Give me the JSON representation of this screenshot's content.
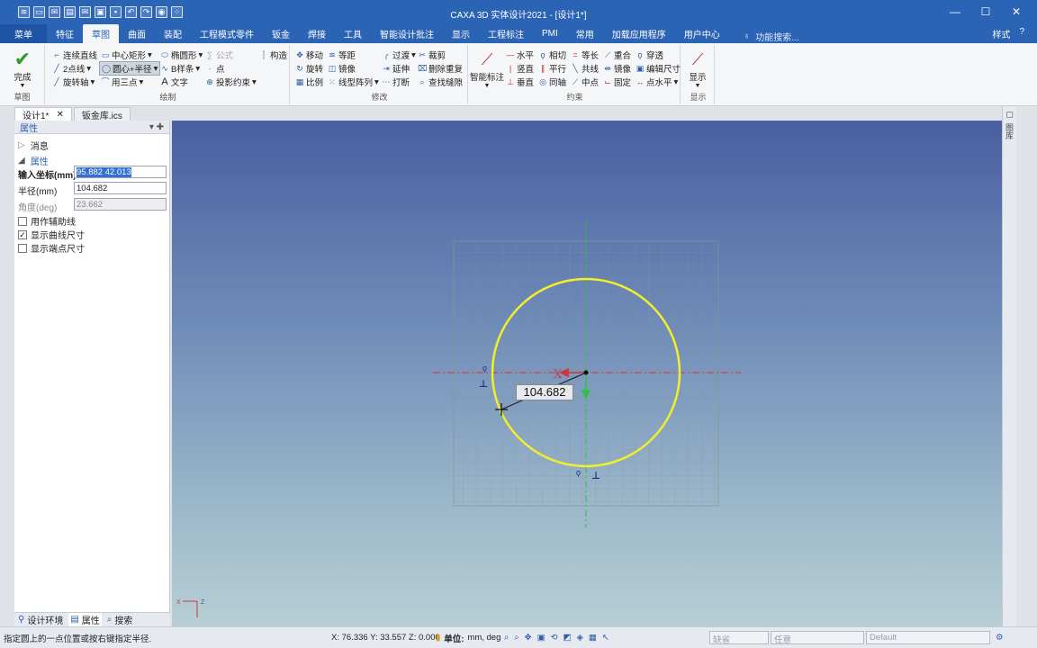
{
  "window": {
    "title": "CAXA 3D 实体设计2021 - [设计1*]",
    "minimize": "—",
    "maximize": "☐",
    "close": "✕"
  },
  "menu": {
    "tabs": [
      "菜单",
      "特征",
      "草图",
      "曲面",
      "装配",
      "工程模式零件",
      "钣金",
      "焊接",
      "工具",
      "智能设计批注",
      "显示",
      "工程标注",
      "PMI",
      "常用",
      "加载应用程序",
      "用户中心"
    ],
    "active_index": 2,
    "search_hint": "功能搜索...",
    "style_label": "样式",
    "help_icon": "?"
  },
  "ribbon": {
    "finish": "完成",
    "draw": {
      "col1": [
        "连续直线",
        "2点线",
        "旋转轴"
      ],
      "col2": [
        "中心矩形",
        "圆心+半径",
        "用三点"
      ],
      "col3": [
        "椭圆形",
        "B样条",
        "文字"
      ],
      "col4": [
        "公式",
        "点",
        "投影约束"
      ],
      "construct": "构造"
    },
    "modify": {
      "col1": [
        "移动",
        "旋转",
        "比例"
      ],
      "col2": [
        "等距",
        "镜像",
        "线型阵列"
      ],
      "col3": [
        "过渡",
        "延伸",
        "打断"
      ],
      "col4": [
        "裁剪",
        "删除重复",
        "查找缝隙"
      ]
    },
    "constraint": {
      "smart": "智能标注",
      "col1": [
        "水平",
        "竖直",
        "垂直"
      ],
      "col2": [
        "相切",
        "平行",
        "同轴"
      ],
      "col3": [
        "等长",
        "共线",
        "中点"
      ],
      "col4": [
        "重合",
        "镜像",
        "固定"
      ],
      "col5": [
        "穿透",
        "编辑尺寸",
        "点水平"
      ]
    },
    "display": "显示",
    "group_labels": {
      "sketch": "草图",
      "draw": "绘制",
      "modify": "修改",
      "constraint": "约束",
      "display": "显示"
    }
  },
  "doc_tabs": [
    "设计1*",
    "钣金库.ics"
  ],
  "panel": {
    "title": "属性",
    "messages": "消息",
    "properties": "属性",
    "input_coord_label": "输入坐标(mm)",
    "input_coord_value": "95.882 42.013",
    "radius_label": "半径(mm)",
    "radius_value": "104.682",
    "angle_label": "角度(deg)",
    "angle_value": "23.662",
    "aux_line": "用作辅助线",
    "show_curve_dim": "显示曲线尺寸",
    "show_endpoint_dim": "显示端点尺寸",
    "aux_checked": false,
    "curve_checked": true,
    "endpoint_checked": false
  },
  "panel_tabs": [
    "设计环境",
    "属性",
    "搜索"
  ],
  "viewport": {
    "dimension_label": "104.682",
    "axis_x": "X",
    "right_strip": "图库",
    "circle_color": "#f2ee2a",
    "grid_color": "#7f9a8e",
    "triad": {
      "x": "X",
      "z": "Z"
    }
  },
  "status": {
    "hint": "指定圆上的一点位置或按右键指定半径.",
    "coords": "X: 76.336 Y: 33.557 Z: 0.000",
    "unit_label": "单位:",
    "unit_value": "mm, deg",
    "combo1": "缺省",
    "combo2": "任意",
    "combo3": "Default"
  }
}
